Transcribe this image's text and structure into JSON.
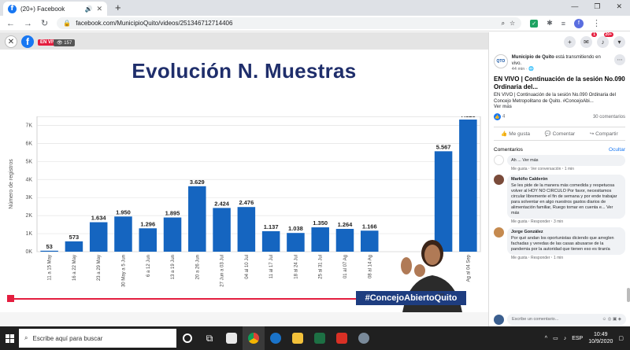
{
  "browser": {
    "tab_title": "(20+) Facebook",
    "audio_icon": "🔊",
    "url": "facebook.com/MunicipioQuito/videos/251346712714406",
    "profile_initial": "f"
  },
  "video": {
    "live_label": "EN VIVO",
    "viewers": "157",
    "chart_title": "Evolución N. Muestras",
    "hashtag": "#ConcejoAbiertoQuito",
    "corner_text": "nan"
  },
  "chart_data": {
    "type": "bar",
    "title": "Evolución N. Muestras",
    "ylabel": "Número de registros",
    "ylim": [
      0,
      7500
    ],
    "yticks": [
      "0K",
      "1K",
      "2K",
      "3K",
      "4K",
      "5K",
      "6K",
      "7K"
    ],
    "categories": [
      "11 a 15 May",
      "16 a 22 May",
      "23 a 29 May",
      "30 May a 5 Jun",
      "6 a 12 Jun",
      "13 a 19 Jun",
      "20 a 26 Jun",
      "27 Jun a 03 Jul",
      "04 al 10 Jul",
      "11 al 17 Jul",
      "18 al 24 Jul",
      "25 al 31 Jul",
      "01 al 07 Ag",
      "08 al 14 Ag",
      "",
      "",
      "",
      "Ag al 04 Sep"
    ],
    "values": [
      53,
      573,
      1634,
      1950,
      1296,
      1895,
      3629,
      2424,
      2476,
      1137,
      1038,
      1350,
      1264,
      1166,
      null,
      null,
      5567,
      7325
    ],
    "labels": [
      "53",
      "573",
      "1.634",
      "1.950",
      "1.296",
      "1.895",
      "3.629",
      "2.424",
      "2.476",
      "1.137",
      "1.038",
      "1.350",
      "1.264",
      "1.166",
      "",
      "",
      "5.567",
      "7.325"
    ],
    "bar_color": "#1565c0",
    "grid": true
  },
  "panel": {
    "messenger_badge": "1",
    "notif_badge": "20+",
    "page_name": "Municipio de Quito",
    "page_action": "está transmitiendo en vivo.",
    "time": "44 min",
    "post_title": "EN VIVO | Continuación de la sesión No.090 Ordinaria del...",
    "post_desc": "EN VIVO | Continuación de la sesión No.090 Ordinaria del Concejo Metropolitano de Quito. #ConcejoAbi...",
    "ver_mas": "Ver más",
    "reactions": "4",
    "comments_count": "30 comentarios",
    "like": "Me gusta",
    "comment": "Comentar",
    "share": "Compartir",
    "comments_header": "Comentarios",
    "hide": "Ocultar"
  },
  "comments": [
    {
      "name": "",
      "text": "Ah ... Ver más",
      "meta": "Me gusta",
      "meta2": "Ver conversación",
      "time": "1 min",
      "color": "#ffffff"
    },
    {
      "name": "Markiño Calderón",
      "text": "Se les pide de la manera más comedida y respetuosa volver al HOY NO CIRCULO Por favor, necesitamos circular libremente el fin de semana y por ende trabajar para solventar en algo nuestros gastos diarios de alimentación familiar, Ruego tomar en cuenta e... Ver más",
      "meta": "Me gusta",
      "meta2": "Responder",
      "time": "3 min",
      "color": "#7a4b3a"
    },
    {
      "name": "Jorge González",
      "text": "Por qué andan los oportunistas diciendo que arreglen fachadas y veredas de las casas abusarse de la pandemia por la autoridad que tienen eso es tiranía",
      "meta": "Me gusta",
      "meta2": "Responder",
      "time": "1 min",
      "color": "#c58a4f"
    }
  ],
  "compose": {
    "placeholder": "Escribe un comentario..."
  },
  "taskbar": {
    "search_placeholder": "Escribe aquí para buscar",
    "lang": "ESP",
    "time": "10:49",
    "date": "10/9/2020"
  }
}
